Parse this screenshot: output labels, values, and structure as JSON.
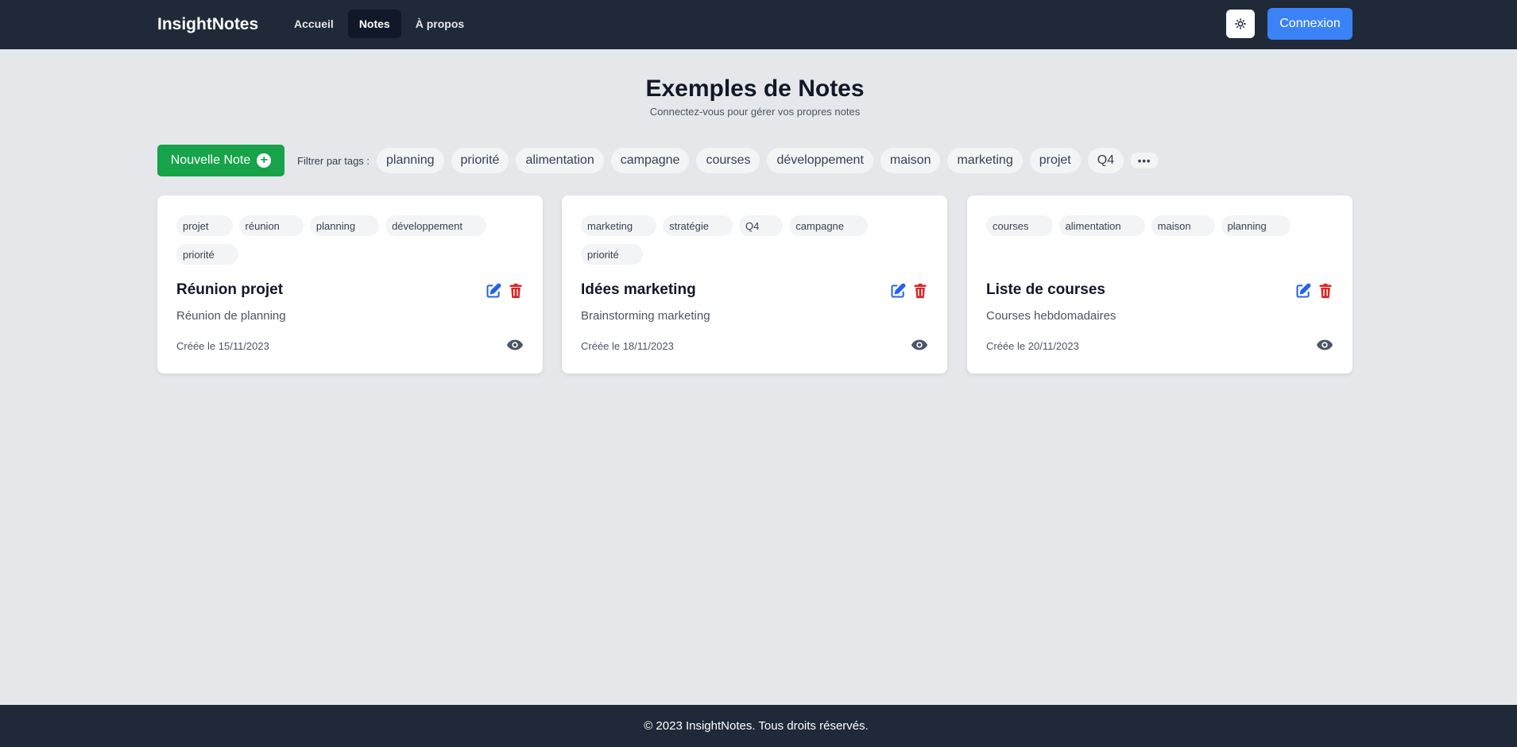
{
  "header": {
    "brand": "InsightNotes",
    "nav": [
      {
        "label": "Accueil"
      },
      {
        "label": "Notes"
      },
      {
        "label": "À propos"
      }
    ],
    "login_label": "Connexion"
  },
  "main": {
    "title": "Exemples de Notes",
    "subtitle": "Connectez-vous pour gérer vos propres notes",
    "new_note_label": "Nouvelle Note",
    "filter_label": "Filtrer par tags :",
    "filter_tags": [
      "planning",
      "priorité",
      "alimentation",
      "campagne",
      "courses",
      "développement",
      "maison",
      "marketing",
      "projet",
      "Q4"
    ]
  },
  "notes": [
    {
      "tags": [
        "projet",
        "réunion",
        "planning",
        "développement",
        "priorité"
      ],
      "title": "Réunion projet",
      "description": "Réunion de planning",
      "created": "Créée le 15/11/2023"
    },
    {
      "tags": [
        "marketing",
        "stratégie",
        "Q4",
        "campagne",
        "priorité"
      ],
      "title": "Idées marketing",
      "description": "Brainstorming marketing",
      "created": "Créée le 18/11/2023"
    },
    {
      "tags": [
        "courses",
        "alimentation",
        "maison",
        "planning"
      ],
      "title": "Liste de courses",
      "description": "Courses hebdomadaires",
      "created": "Créée le 20/11/2023"
    }
  ],
  "footer": {
    "text": "© 2023 InsightNotes. Tous droits réservés."
  },
  "colors": {
    "header_bg": "#1f2937",
    "accent_blue": "#3b82f6",
    "accent_green": "#16a34a",
    "danger_red": "#dc2626",
    "edit_blue": "#2563eb"
  },
  "icons": {
    "theme": "sun-icon",
    "new_note": "plus-circle-icon",
    "more": "ellipsis-icon",
    "edit": "edit-icon",
    "delete": "trash-icon",
    "view": "eye-icon"
  }
}
